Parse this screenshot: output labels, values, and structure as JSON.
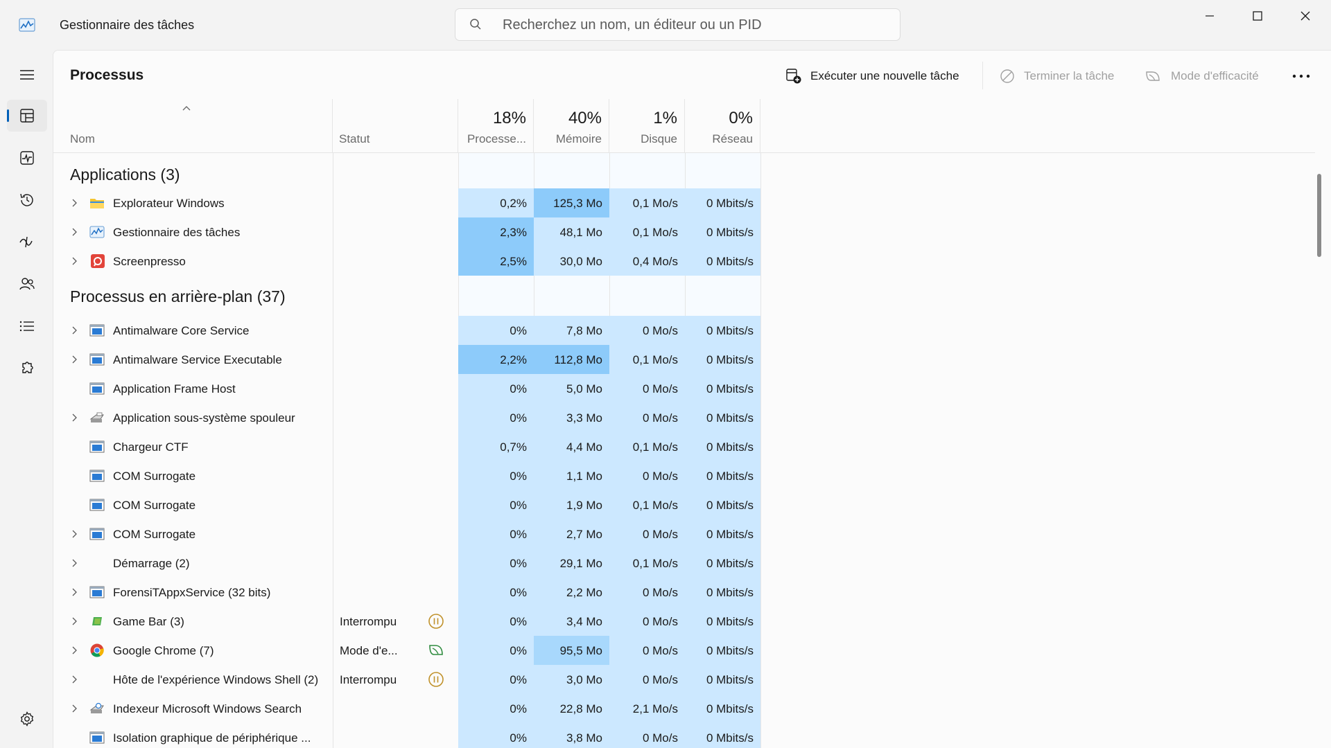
{
  "app": {
    "title": "Gestionnaire des tâches"
  },
  "search": {
    "placeholder": "Recherchez un nom, un éditeur ou un PID"
  },
  "page": {
    "title": "Processus"
  },
  "toolbar": {
    "run_label": "Exécuter une nouvelle tâche",
    "end_label": "Terminer la tâche",
    "efficiency_label": "Mode d'efficacité"
  },
  "columns": {
    "name": "Nom",
    "status": "Statut",
    "cpu": {
      "pct": "18%",
      "label": "Processe..."
    },
    "memory": {
      "pct": "40%",
      "label": "Mémoire"
    },
    "disk": {
      "pct": "1%",
      "label": "Disque"
    },
    "network": {
      "pct": "0%",
      "label": "Réseau"
    }
  },
  "sections": {
    "apps": "Applications (3)",
    "background": "Processus en arrière-plan (37)"
  },
  "apps": [
    {
      "name": "Explorateur Windows",
      "icon": "folder-icon",
      "cpu": "0,2%",
      "mem": "125,3 Mo",
      "disk": "0,1 Mo/s",
      "net": "0 Mbits/s"
    },
    {
      "name": "Gestionnaire des tâches",
      "icon": "task-manager-icon",
      "cpu": "2,3%",
      "mem": "48,1 Mo",
      "disk": "0,1 Mo/s",
      "net": "0 Mbits/s"
    },
    {
      "name": "Screenpresso",
      "icon": "screenpresso-icon",
      "cpu": "2,5%",
      "mem": "30,0 Mo",
      "disk": "0,4 Mo/s",
      "net": "0 Mbits/s"
    }
  ],
  "background": [
    {
      "name": "Antimalware Core Service",
      "status": "",
      "cpu": "0%",
      "mem": "7,8 Mo",
      "disk": "0 Mo/s",
      "net": "0 Mbits/s"
    },
    {
      "name": "Antimalware Service Executable",
      "status": "",
      "cpu": "2,2%",
      "mem": "112,8 Mo",
      "disk": "0,1 Mo/s",
      "net": "0 Mbits/s"
    },
    {
      "name": "Application Frame Host",
      "status": "",
      "cpu": "0%",
      "mem": "5,0 Mo",
      "disk": "0 Mo/s",
      "net": "0 Mbits/s"
    },
    {
      "name": "Application sous-système spouleur",
      "status": "",
      "cpu": "0%",
      "mem": "3,3 Mo",
      "disk": "0 Mo/s",
      "net": "0 Mbits/s"
    },
    {
      "name": "Chargeur CTF",
      "status": "",
      "cpu": "0,7%",
      "mem": "4,4 Mo",
      "disk": "0,1 Mo/s",
      "net": "0 Mbits/s"
    },
    {
      "name": "COM Surrogate",
      "status": "",
      "cpu": "0%",
      "mem": "1,1 Mo",
      "disk": "0 Mo/s",
      "net": "0 Mbits/s"
    },
    {
      "name": "COM Surrogate",
      "status": "",
      "cpu": "0%",
      "mem": "1,9 Mo",
      "disk": "0,1 Mo/s",
      "net": "0 Mbits/s"
    },
    {
      "name": "COM Surrogate",
      "status": "",
      "cpu": "0%",
      "mem": "2,7 Mo",
      "disk": "0 Mo/s",
      "net": "0 Mbits/s"
    },
    {
      "name": "Démarrage (2)",
      "status": "",
      "cpu": "0%",
      "mem": "29,1 Mo",
      "disk": "0,1 Mo/s",
      "net": "0 Mbits/s"
    },
    {
      "name": "ForensiTAppxService (32 bits)",
      "status": "",
      "cpu": "0%",
      "mem": "2,2 Mo",
      "disk": "0 Mo/s",
      "net": "0 Mbits/s"
    },
    {
      "name": "Game Bar (3)",
      "status": "Interrompu",
      "cpu": "0%",
      "mem": "3,4 Mo",
      "disk": "0 Mo/s",
      "net": "0 Mbits/s"
    },
    {
      "name": "Google Chrome (7)",
      "status": "Mode d'e...",
      "cpu": "0%",
      "mem": "95,5 Mo",
      "disk": "0 Mo/s",
      "net": "0 Mbits/s"
    },
    {
      "name": "Hôte de l'expérience Windows Shell (2)",
      "status": "Interrompu",
      "cpu": "0%",
      "mem": "3,0 Mo",
      "disk": "0 Mo/s",
      "net": "0 Mbits/s"
    },
    {
      "name": "Indexeur Microsoft Windows Search",
      "status": "",
      "cpu": "0%",
      "mem": "22,8 Mo",
      "disk": "2,1 Mo/s",
      "net": "0 Mbits/s"
    },
    {
      "name": "Isolation graphique de périphérique ...",
      "status": "",
      "cpu": "0%",
      "mem": "3,8 Mo",
      "disk": "0 Mo/s",
      "net": "0 Mbits/s"
    }
  ],
  "colors": {
    "accent": "#005fb8",
    "heat_light": "#cce8ff",
    "heat_mid": "#a8d8fc",
    "heat_high": "#8dcbfa",
    "paused": "#c0912a",
    "efficiency": "#2e8b3e"
  }
}
